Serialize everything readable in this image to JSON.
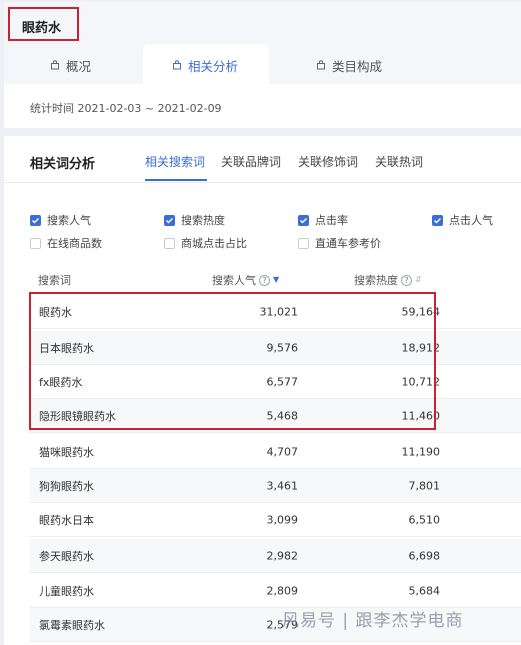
{
  "header": {
    "title": "眼药水"
  },
  "tabs": [
    {
      "label": "概况",
      "icon": "bag-icon",
      "active": false
    },
    {
      "label": "相关分析",
      "icon": "bag-icon",
      "active": true
    },
    {
      "label": "类目构成",
      "icon": "bag-icon",
      "active": false
    }
  ],
  "stat_time": "统计时间 2021-02-03 ~ 2021-02-09",
  "section": {
    "title": "相关词分析",
    "subtabs": [
      "相关搜索词",
      "关联品牌词",
      "关联修饰词",
      "关联热词"
    ]
  },
  "checkboxes": [
    {
      "label": "搜索人气",
      "checked": true
    },
    {
      "label": "搜索热度",
      "checked": true
    },
    {
      "label": "点击率",
      "checked": true
    },
    {
      "label": "点击人气",
      "checked": true
    },
    {
      "label": "在线商品数",
      "checked": false
    },
    {
      "label": "商城点击占比",
      "checked": false
    },
    {
      "label": "直通车参考价",
      "checked": false
    }
  ],
  "table": {
    "headers": {
      "keyword": "搜索词",
      "popularity": "搜索人气",
      "heat": "搜索热度"
    },
    "rows": [
      {
        "keyword": "眼药水",
        "popularity": "31,021",
        "heat": "59,164"
      },
      {
        "keyword": "日本眼药水",
        "popularity": "9,576",
        "heat": "18,912"
      },
      {
        "keyword": "fx眼药水",
        "popularity": "6,577",
        "heat": "10,712"
      },
      {
        "keyword": "隐形眼镜眼药水",
        "popularity": "5,468",
        "heat": "11,460"
      },
      {
        "keyword": "猫咪眼药水",
        "popularity": "4,707",
        "heat": "11,190"
      },
      {
        "keyword": "狗狗眼药水",
        "popularity": "3,461",
        "heat": "7,801"
      },
      {
        "keyword": "眼药水日本",
        "popularity": "3,099",
        "heat": "6,510"
      },
      {
        "keyword": "参天眼药水",
        "popularity": "2,982",
        "heat": "6,698"
      },
      {
        "keyword": "儿童眼药水",
        "popularity": "2,809",
        "heat": "5,684"
      },
      {
        "keyword": "氯霉素眼药水",
        "popularity": "2,579",
        "heat": ""
      }
    ]
  },
  "watermark": "风易号 | 跟李杰学电商",
  "colors": {
    "accent": "#3a6ed6",
    "highlight": "#c8242f"
  }
}
